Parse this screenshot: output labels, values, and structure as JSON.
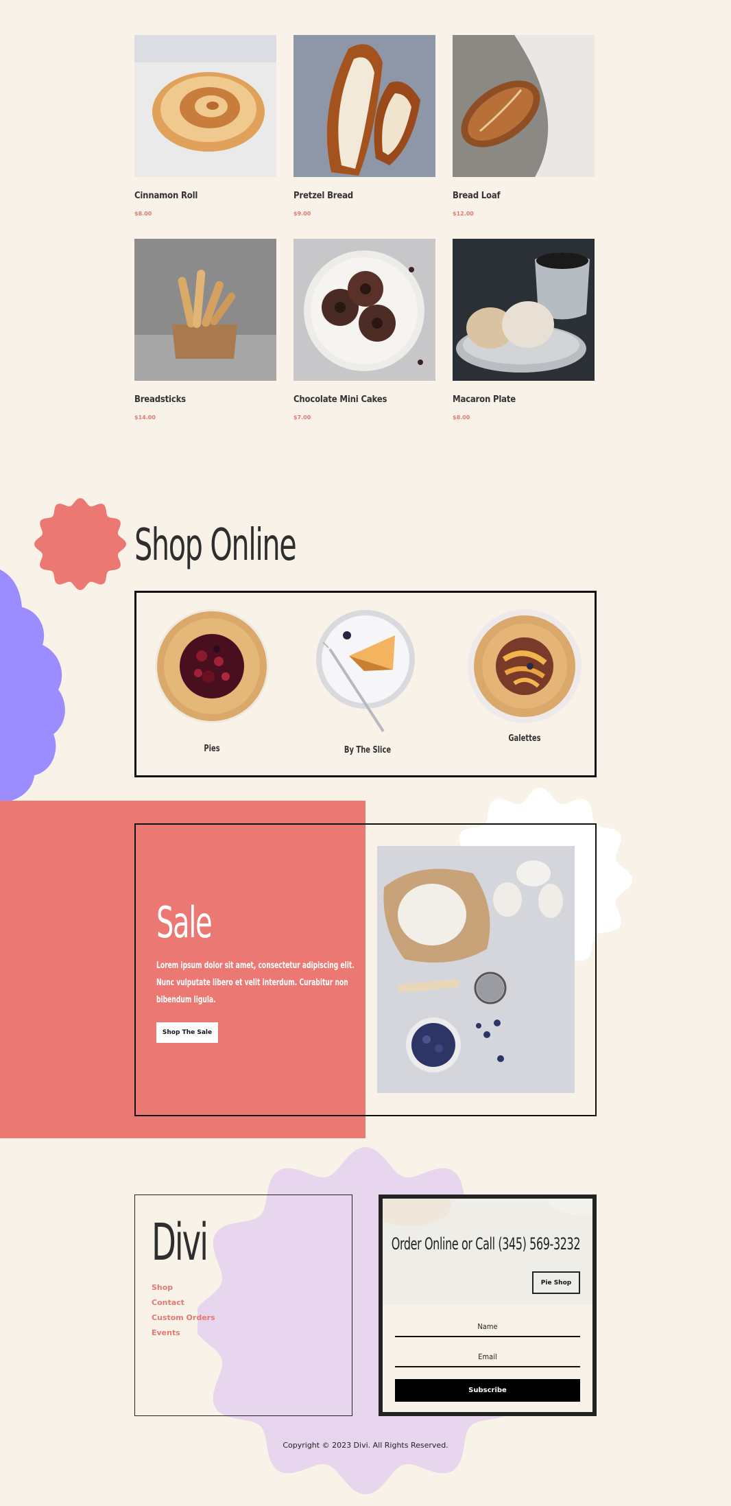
{
  "products": [
    {
      "name": "Cinnamon Roll",
      "price": "$8.00",
      "image": "cinnamon-roll"
    },
    {
      "name": "Pretzel Bread",
      "price": "$9.00",
      "image": "pretzel-bread"
    },
    {
      "name": "Bread Loaf",
      "price": "$12.00",
      "image": "bread-loaf"
    },
    {
      "name": "Breadsticks",
      "price": "$14.00",
      "image": "breadsticks"
    },
    {
      "name": "Chocolate Mini Cakes",
      "price": "$7.00",
      "image": "chocolate-mini-cakes"
    },
    {
      "name": "Macaron Plate",
      "price": "$8.00",
      "image": "macaron-plate"
    }
  ],
  "shop": {
    "title": "Shop Online",
    "categories": [
      {
        "label": "Pies",
        "image": "berry-galette"
      },
      {
        "label": "By The Slice",
        "image": "pie-slice"
      },
      {
        "label": "Galettes",
        "image": "peach-galette"
      }
    ]
  },
  "sale": {
    "title": "Sale",
    "text": "Lorem ipsum dolor sit amet, consectetur adipiscing elit. Nunc vulputate libero et velit interdum. Curabitur non bibendum ligula.",
    "button": "Shop The Sale"
  },
  "footer": {
    "logo": "Divi",
    "links": [
      "Shop",
      "Contact",
      "Custom Orders",
      "Events"
    ],
    "order_title": "Order Online or Call (345) 569-3232",
    "pie_shop_button": "Pie Shop",
    "name_placeholder": "Name",
    "email_placeholder": "Email",
    "subscribe_button": "Subscribe",
    "copyright": "Copyright © 2023 Divi. All Rights Reserved."
  },
  "colors": {
    "background": "#f8f2e8",
    "coral": "#ec7873",
    "purple": "#9b8cff",
    "lavender": "#e7d6ee",
    "price": "#e07a74"
  }
}
